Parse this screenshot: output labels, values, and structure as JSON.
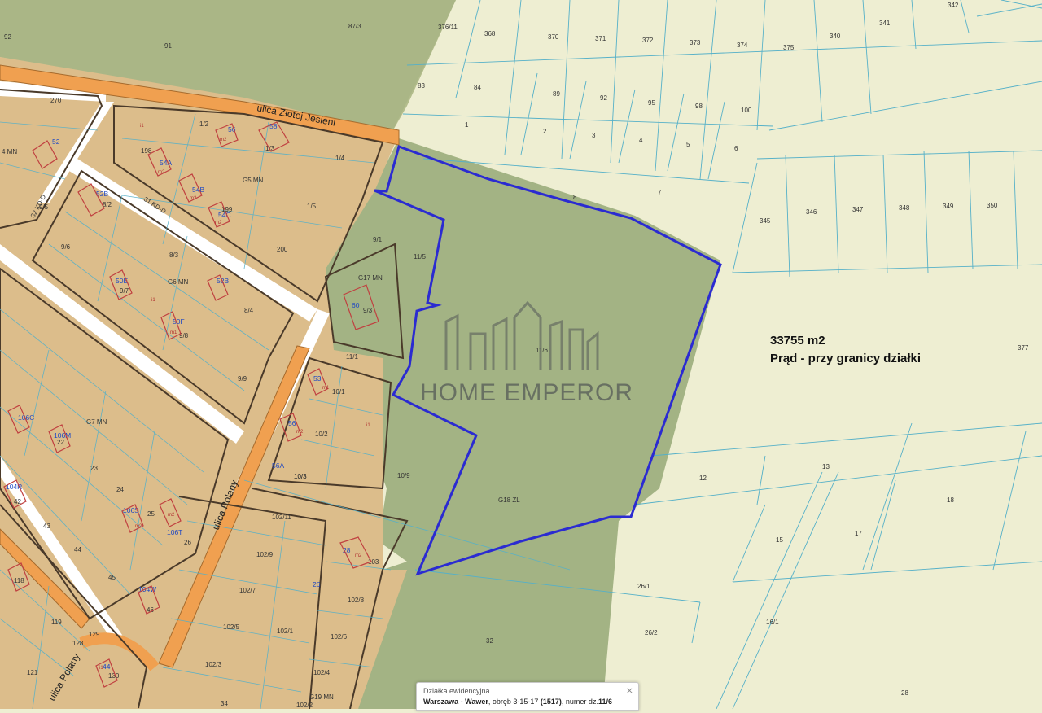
{
  "map": {
    "streets": [
      {
        "name": "street-zlotej-jesieni",
        "text": "ulica Złotej Jesieni"
      },
      {
        "name": "street-polany",
        "text": "ulica Polany"
      },
      {
        "name": "street-polany-2",
        "text": "ulica Polany"
      },
      {
        "name": "road-32kd",
        "text": "32 KD-D"
      },
      {
        "name": "road-31kd",
        "text": "31 KD-D"
      }
    ],
    "zones": [
      "G5 MN",
      "G6 MN",
      "G7 MN",
      "G17 MN",
      "G18 ZL",
      "G19 MN",
      "4 MN"
    ],
    "parcels": [
      "92",
      "91",
      "87/3",
      "376/11",
      "368",
      "370",
      "371",
      "372",
      "373",
      "374",
      "375",
      "340",
      "341",
      "342",
      "83",
      "84",
      "89",
      "92",
      "95",
      "98",
      "100",
      "1",
      "2",
      "3",
      "4",
      "5",
      "6",
      "7",
      "8",
      "345",
      "346",
      "347",
      "348",
      "349",
      "350",
      "270",
      "1/2",
      "1/3",
      "1/4",
      "1/5",
      "198",
      "199",
      "200",
      "9/5",
      "8/2",
      "8/3",
      "9/6",
      "9/7",
      "8/4",
      "9/8",
      "9/9",
      "9/1",
      "11/5",
      "9/3",
      "11/1",
      "11/6",
      "10/1",
      "10/2",
      "10/3",
      "10/9",
      "102/11",
      "102/9",
      "102/7",
      "102/5",
      "102/3",
      "102/1",
      "102/2",
      "102/4",
      "102/6",
      "102/8",
      "103",
      "377",
      "12",
      "13",
      "15",
      "16/1",
      "17",
      "18",
      "26/1",
      "26/2",
      "28",
      "32",
      "10/3",
      "23",
      "24",
      "25",
      "26",
      "42",
      "43",
      "44",
      "45",
      "46",
      "118",
      "119",
      "121",
      "128",
      "129",
      "130",
      "34",
      "22"
    ],
    "house_numbers": [
      "56",
      "58",
      "52",
      "54A",
      "54B",
      "54C",
      "52B",
      "50E",
      "52B",
      "50F",
      "53",
      "56",
      "56A",
      "60",
      "28",
      "26",
      "106C",
      "106M",
      "104R",
      "106S",
      "106T",
      "104W",
      "44"
    ],
    "symbols": [
      "m2",
      "m1",
      "i1"
    ]
  },
  "overlay": {
    "area": "33755 m2",
    "utility": "Prąd - przy granicy działki"
  },
  "watermark": {
    "text": "HOME EMPEROR"
  },
  "popup": {
    "title": "Działka ewidencyjna",
    "location": "Warszawa - Wawer",
    "details_prefix": ", obręb 3-15-17 ",
    "obreb_code": "(1517)",
    "numer_prefix": ", numer dz.",
    "parcel_number": "11/6",
    "close": "⨯"
  },
  "colors": {
    "background": "#eeeed2",
    "forest": "#9fb080",
    "forest_dark": "#b0be8e",
    "residential": "#dcbd8b",
    "road": "#ffffff",
    "main_road": "#f0a050",
    "boundary": "#2b2bd1",
    "parcel_line": "#55b0c8"
  }
}
